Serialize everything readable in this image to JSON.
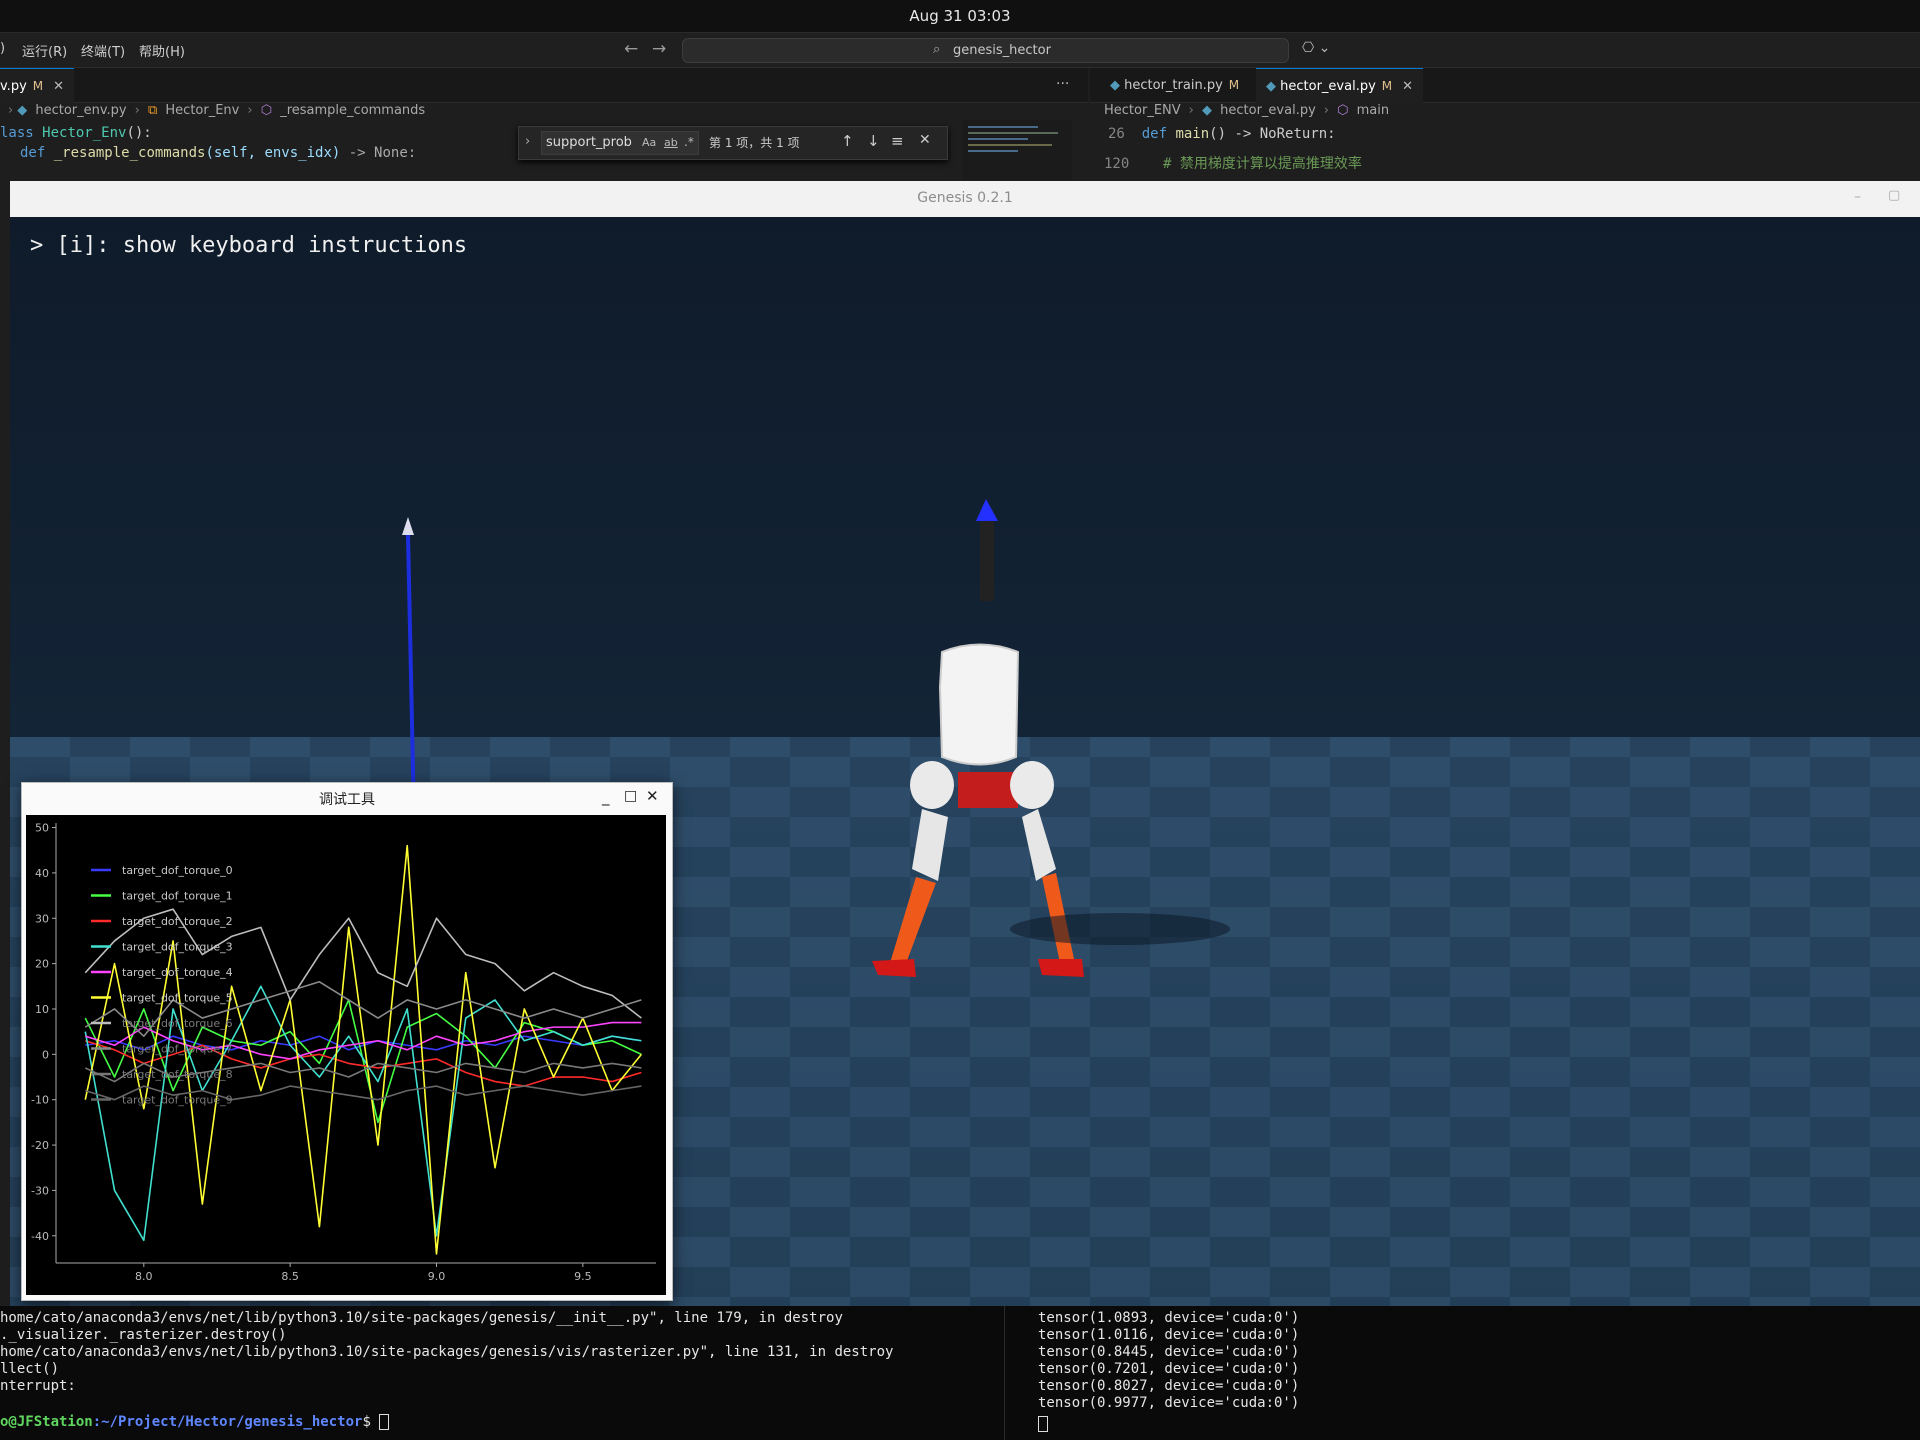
{
  "system": {
    "clock": "Aug 31  03:03"
  },
  "menubar": {
    "items": [
      "运行(R)",
      "终端(T)",
      "帮助(H)"
    ],
    "search_text": "genesis_hector"
  },
  "tabs_left": {
    "file_label": "v.py",
    "modified": "M"
  },
  "tabs_right": [
    {
      "label": "hector_train.py",
      "modified": "M"
    },
    {
      "label": "hector_eval.py",
      "modified": "M"
    }
  ],
  "breadcrumb_left": {
    "file": "hector_env.py",
    "class": "Hector_Env",
    "method": "_resample_commands"
  },
  "breadcrumb_right": {
    "folder": "Hector_ENV",
    "file": "hector_eval.py",
    "symbol": "main"
  },
  "code_left": {
    "line1_kw": "lass",
    "line1_cls": "Hector_Env",
    "line1_rest": "():",
    "line2_kw": "def",
    "line2_fn": "_resample_commands",
    "line2_args": "(self, envs_idx)",
    "line2_rest": " -> None:"
  },
  "code_right": {
    "line1_num": "26",
    "line1_kw": "def",
    "line1_fn": "main",
    "line1_rest": "() -> NoReturn:",
    "line2_num": "120",
    "line2_comment": "# 禁用梯度计算以提高推理效率"
  },
  "find_widget": {
    "query": "support_prob",
    "opt_case": "Aa",
    "opt_word": "ab",
    "opt_regex": ".*",
    "result": "第 1 项，共 1 项"
  },
  "genesis": {
    "title": "Genesis 0.2.1",
    "instruction": "> [i]: show keyboard instructions"
  },
  "debug_window": {
    "title": "调试工具"
  },
  "chart_data": {
    "type": "line",
    "title": "",
    "xlabel": "",
    "ylabel": "",
    "xlim": [
      7.7,
      9.75
    ],
    "ylim": [
      -46,
      51
    ],
    "x_ticks": [
      8.0,
      8.5,
      9.0,
      9.5
    ],
    "y_ticks": [
      50,
      40,
      30,
      20,
      10,
      0,
      -10,
      -20,
      -30,
      -40
    ],
    "grid": false,
    "legend_position": "top-left",
    "x": [
      7.8,
      7.9,
      8.0,
      8.1,
      8.2,
      8.3,
      8.4,
      8.5,
      8.6,
      8.7,
      8.8,
      8.9,
      9.0,
      9.1,
      9.2,
      9.3,
      9.4,
      9.5,
      9.6,
      9.7
    ],
    "series": [
      {
        "name": "target_dof_torque_0",
        "color": "#3a3aff",
        "values": [
          2,
          3,
          1,
          4,
          2,
          1,
          3,
          2,
          4,
          1,
          3,
          2,
          1,
          3,
          2,
          4,
          3,
          2,
          4,
          3
        ]
      },
      {
        "name": "target_dof_torque_1",
        "color": "#44ff44",
        "values": [
          8,
          -5,
          10,
          -8,
          6,
          3,
          2,
          5,
          -2,
          12,
          -15,
          6,
          9,
          4,
          -3,
          7,
          5,
          2,
          3,
          0
        ]
      },
      {
        "name": "target_dof_torque_2",
        "color": "#ff2a2a",
        "values": [
          3,
          1,
          -2,
          0,
          2,
          -1,
          -3,
          -1,
          0,
          -2,
          -3,
          -2,
          -1,
          -4,
          -6,
          -7,
          -5,
          -5,
          -6,
          -4
        ]
      },
      {
        "name": "target_dof_torque_3",
        "color": "#40e0d0",
        "values": [
          5,
          -30,
          -41,
          10,
          -8,
          3,
          15,
          2,
          -5,
          4,
          -6,
          10,
          -40,
          8,
          12,
          3,
          5,
          2,
          4,
          3
        ]
      },
      {
        "name": "target_dof_torque_4",
        "color": "#ff44ff",
        "values": [
          4,
          2,
          6,
          3,
          1,
          2,
          0,
          -1,
          1,
          2,
          3,
          1,
          4,
          2,
          3,
          5,
          6,
          6,
          7,
          7
        ]
      },
      {
        "name": "target_dof_torque_5",
        "color": "#ffff33",
        "values": [
          -10,
          20,
          -12,
          25,
          -33,
          15,
          -8,
          12,
          -38,
          28,
          -20,
          46,
          -44,
          18,
          -25,
          10,
          -5,
          8,
          -8,
          0
        ]
      },
      {
        "name": "target_dof_torque_6",
        "color": "#bdbdbd",
        "values": [
          18,
          25,
          30,
          32,
          22,
          26,
          28,
          12,
          22,
          30,
          18,
          15,
          30,
          22,
          20,
          14,
          18,
          15,
          13,
          8
        ]
      },
      {
        "name": "target_dof_torque_7",
        "color": "#8a8a8a",
        "values": [
          6,
          10,
          4,
          12,
          8,
          10,
          12,
          14,
          16,
          12,
          8,
          12,
          10,
          12,
          10,
          8,
          10,
          8,
          10,
          12
        ]
      },
      {
        "name": "target_dof_torque_8",
        "color": "#777777",
        "values": [
          -3,
          -6,
          -2,
          -5,
          -4,
          -3,
          -2,
          -4,
          -3,
          -5,
          -2,
          -3,
          -4,
          -2,
          -3,
          -4,
          -2,
          -3,
          -2,
          -3
        ]
      },
      {
        "name": "target_dof_torque_9",
        "color": "#666666",
        "values": [
          -8,
          -10,
          -7,
          -9,
          -8,
          -10,
          -9,
          -7,
          -8,
          -9,
          -10,
          -8,
          -7,
          -9,
          -8,
          -7,
          -8,
          -9,
          -8,
          -7
        ]
      }
    ]
  },
  "terminal_left": [
    "home/cato/anaconda3/envs/net/lib/python3.10/site-packages/genesis/__init__.py\", line 179, in destroy",
    "._visualizer._rasterizer.destroy()",
    "home/cato/anaconda3/envs/net/lib/python3.10/site-packages/genesis/vis/rasterizer.py\", line 131, in destroy",
    "llect()",
    "nterrupt:"
  ],
  "terminal_prompt": {
    "user": "o@JFStation",
    "path": ":~/Project/Hector/genesis_hector",
    "symbol": "$"
  },
  "terminal_right": [
    "tensor(1.0893, device='cuda:0')",
    "tensor(1.0116, device='cuda:0')",
    "tensor(0.8445, device='cuda:0')",
    "tensor(0.7201, device='cuda:0')",
    "tensor(0.8027, device='cuda:0')",
    "tensor(0.9977, device='cuda:0')"
  ]
}
